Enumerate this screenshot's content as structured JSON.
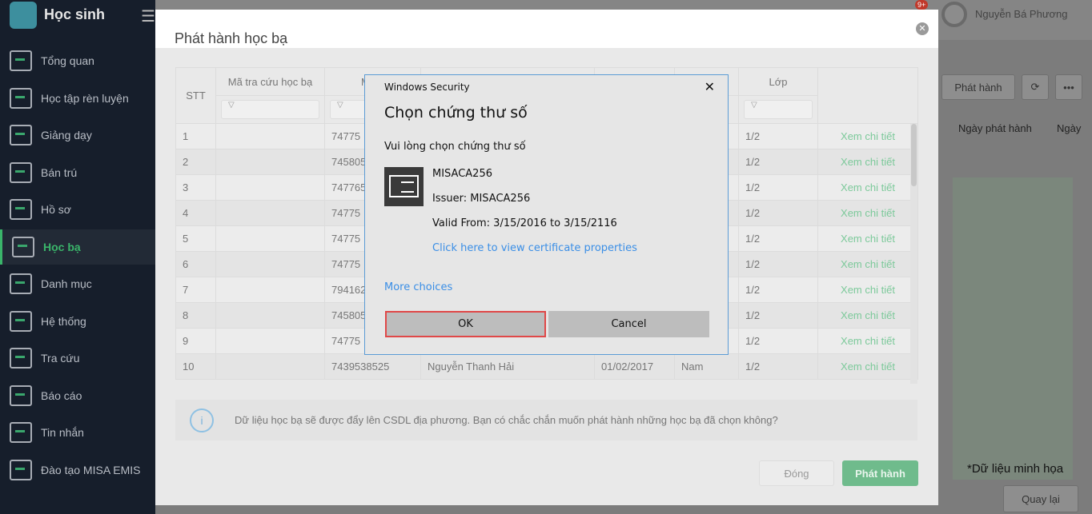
{
  "app": {
    "title": "Học sinh",
    "user": "Nguyễn Bá Phương",
    "notif_badge": "9+"
  },
  "sidebar": {
    "items": [
      {
        "label": "Tổng quan"
      },
      {
        "label": "Học tập rèn luyện"
      },
      {
        "label": "Giảng dạy"
      },
      {
        "label": "Bán trú"
      },
      {
        "label": "Hồ sơ"
      },
      {
        "label": "Học bạ",
        "active": true
      },
      {
        "label": "Danh mục"
      },
      {
        "label": "Hệ thống"
      },
      {
        "label": "Tra cứu"
      },
      {
        "label": "Báo cáo"
      },
      {
        "label": "Tin nhắn"
      },
      {
        "label": "Đào tạo MISA EMIS"
      }
    ]
  },
  "background": {
    "publish_label": "Phát hành",
    "col_publish_date": "Ngày phát hành",
    "col_next": "Ngày",
    "back_label": "Quay lại",
    "note": "*Dữ liệu minh họa"
  },
  "modal": {
    "title": "Phát hành học bạ",
    "columns": [
      "STT",
      "Mã tra cứu học bạ",
      "Mã h",
      "",
      "",
      "",
      "Lớp",
      ""
    ],
    "rows": [
      {
        "stt": "1",
        "code": "74775",
        "name": "",
        "dob": "",
        "gender": "",
        "class": "1/2",
        "action": "Xem chi tiết"
      },
      {
        "stt": "2",
        "code": "745805",
        "name": "",
        "dob": "",
        "gender": "",
        "class": "1/2",
        "action": "Xem chi tiết"
      },
      {
        "stt": "3",
        "code": "747765",
        "name": "",
        "dob": "",
        "gender": "",
        "class": "1/2",
        "action": "Xem chi tiết"
      },
      {
        "stt": "4",
        "code": "74775",
        "name": "",
        "dob": "",
        "gender": "",
        "class": "1/2",
        "action": "Xem chi tiết"
      },
      {
        "stt": "5",
        "code": "74775",
        "name": "",
        "dob": "",
        "gender": "",
        "class": "1/2",
        "action": "Xem chi tiết"
      },
      {
        "stt": "6",
        "code": "74775",
        "name": "",
        "dob": "",
        "gender": "",
        "class": "1/2",
        "action": "Xem chi tiết"
      },
      {
        "stt": "7",
        "code": "794162",
        "name": "",
        "dob": "",
        "gender": "",
        "class": "1/2",
        "action": "Xem chi tiết"
      },
      {
        "stt": "8",
        "code": "745805",
        "name": "",
        "dob": "",
        "gender": "",
        "class": "1/2",
        "action": "Xem chi tiết"
      },
      {
        "stt": "9",
        "code": "74775",
        "name": "",
        "dob": "",
        "gender": "",
        "class": "1/2",
        "action": "Xem chi tiết"
      },
      {
        "stt": "10",
        "code": "7439538525",
        "name": "Nguyễn Thanh Hải",
        "dob": "01/02/2017",
        "gender": "Nam",
        "class": "1/2",
        "action": "Xem chi tiết"
      }
    ],
    "info": "Dữ liệu học bạ sẽ được đẩy lên CSDL địa phương. Bạn có chắc chắn muốn phát hành những học bạ đã chọn không?",
    "close_label": "Đóng",
    "publish_label": "Phát hành"
  },
  "win_dialog": {
    "caption": "Windows Security",
    "title": "Chọn chứng thư số",
    "subtitle": "Vui lòng chọn chứng thư số",
    "cert_name": "MISACA256",
    "issuer": "Issuer: MISACA256",
    "valid": "Valid From: 3/15/2016 to 3/15/2116",
    "view_props": "Click here to view certificate properties",
    "more_choices": "More choices",
    "ok": "OK",
    "cancel": "Cancel"
  },
  "colors": {
    "accent": "#3ab56a",
    "link": "#3a8ee6",
    "ok_highlight": "#e04848"
  }
}
